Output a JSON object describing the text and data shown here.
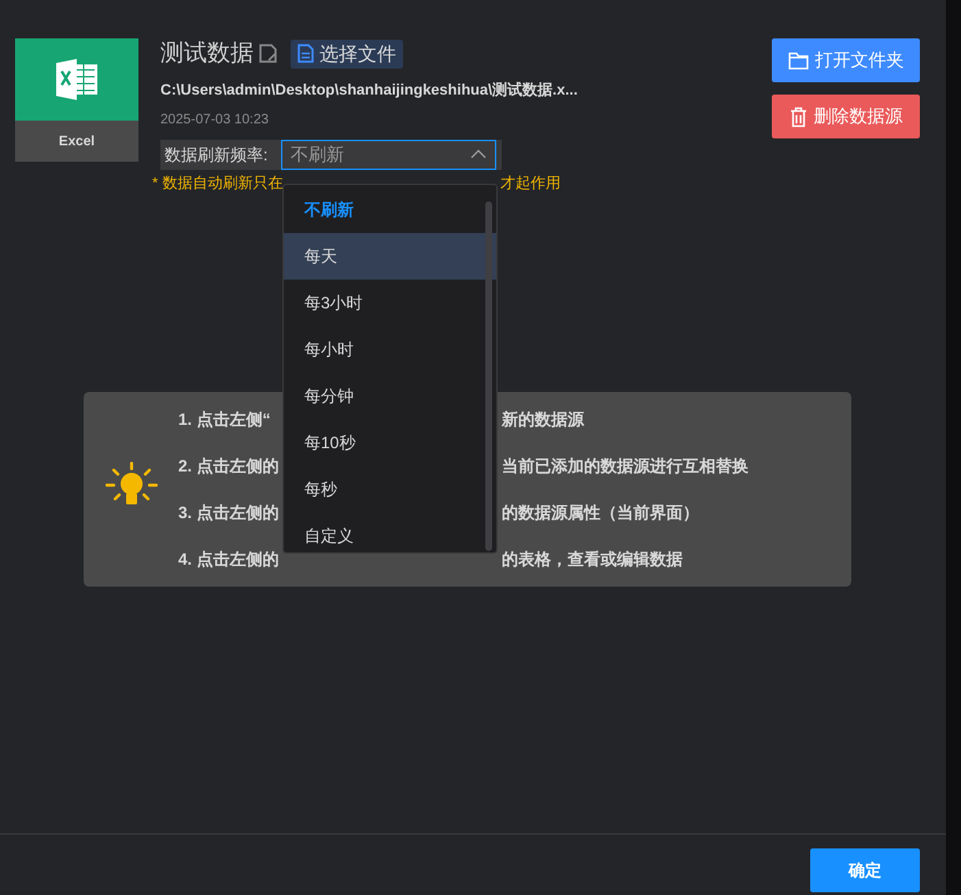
{
  "file": {
    "type_label": "Excel",
    "name": "测试数据",
    "choose_button": "选择文件",
    "path": "C:\\Users\\admin\\Desktop\\shanhaijingkeshihua\\测试数据.x...",
    "date": "2025-07-03 10:23"
  },
  "refresh": {
    "label": "数据刷新频率:",
    "value": "不刷新",
    "expanded": true,
    "options": [
      {
        "label": "不刷新",
        "selected": true,
        "hovered": false
      },
      {
        "label": "每天",
        "selected": false,
        "hovered": true
      },
      {
        "label": "每3小时",
        "selected": false,
        "hovered": false
      },
      {
        "label": "每小时",
        "selected": false,
        "hovered": false
      },
      {
        "label": "每分钟",
        "selected": false,
        "hovered": false
      },
      {
        "label": "每10秒",
        "selected": false,
        "hovered": false
      },
      {
        "label": "每秒",
        "selected": false,
        "hovered": false
      },
      {
        "label": "自定义",
        "selected": false,
        "hovered": false
      }
    ]
  },
  "note": {
    "start": "* 数据自动刷新只在",
    "end": "才起作用"
  },
  "actions": [
    "打开文件夹",
    "删除数据源"
  ],
  "tips": [
    {
      "start": "1. 点击左侧“",
      "end": "新的数据源"
    },
    {
      "start": "2. 点击左侧的",
      "end": "当前已添加的数据源进行互相替换"
    },
    {
      "start": "3. 点击左侧的",
      "end": "的数据源属性（当前界面）"
    },
    {
      "start": "4. 点击左侧的",
      "end": "的表格，查看或编辑数据"
    }
  ],
  "confirm": "确定"
}
